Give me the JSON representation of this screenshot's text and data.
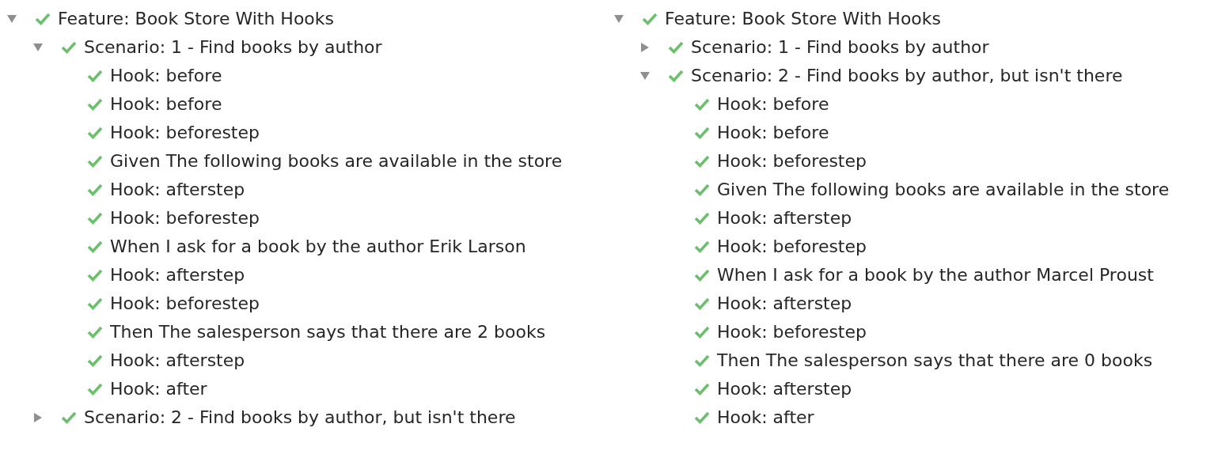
{
  "panels": [
    {
      "nodes": [
        {
          "label": "Feature: Book Store With Hooks",
          "passed": true,
          "expanded": true,
          "children": [
            {
              "label": "Scenario: 1 - Find books by author",
              "passed": true,
              "expanded": true,
              "children": [
                {
                  "label": "Hook: before",
                  "passed": true
                },
                {
                  "label": "Hook: before",
                  "passed": true
                },
                {
                  "label": "Hook: beforestep",
                  "passed": true
                },
                {
                  "label": "Given The following books are available in the store",
                  "passed": true
                },
                {
                  "label": "Hook: afterstep",
                  "passed": true
                },
                {
                  "label": "Hook: beforestep",
                  "passed": true
                },
                {
                  "label": "When I ask for a book by the author Erik Larson",
                  "passed": true
                },
                {
                  "label": "Hook: afterstep",
                  "passed": true
                },
                {
                  "label": "Hook: beforestep",
                  "passed": true
                },
                {
                  "label": "Then The salesperson says that there are 2 books",
                  "passed": true
                },
                {
                  "label": "Hook: afterstep",
                  "passed": true
                },
                {
                  "label": "Hook: after",
                  "passed": true
                }
              ]
            },
            {
              "label": "Scenario: 2 - Find books by author, but isn't there",
              "passed": true,
              "expanded": false
            }
          ]
        }
      ]
    },
    {
      "nodes": [
        {
          "label": "Feature: Book Store With Hooks",
          "passed": true,
          "expanded": true,
          "children": [
            {
              "label": "Scenario: 1 - Find books by author",
              "passed": true,
              "expanded": false
            },
            {
              "label": "Scenario: 2 - Find books by author, but isn't there",
              "passed": true,
              "expanded": true,
              "children": [
                {
                  "label": "Hook: before",
                  "passed": true
                },
                {
                  "label": "Hook: before",
                  "passed": true
                },
                {
                  "label": "Hook: beforestep",
                  "passed": true
                },
                {
                  "label": "Given The following books are available in the store",
                  "passed": true
                },
                {
                  "label": "Hook: afterstep",
                  "passed": true
                },
                {
                  "label": "Hook: beforestep",
                  "passed": true
                },
                {
                  "label": "When I ask for a book by the author Marcel Proust",
                  "passed": true
                },
                {
                  "label": "Hook: afterstep",
                  "passed": true
                },
                {
                  "label": "Hook: beforestep",
                  "passed": true
                },
                {
                  "label": "Then The salesperson says that there are 0 books",
                  "passed": true
                },
                {
                  "label": "Hook: afterstep",
                  "passed": true
                },
                {
                  "label": "Hook: after",
                  "passed": true
                }
              ]
            }
          ]
        }
      ]
    }
  ]
}
